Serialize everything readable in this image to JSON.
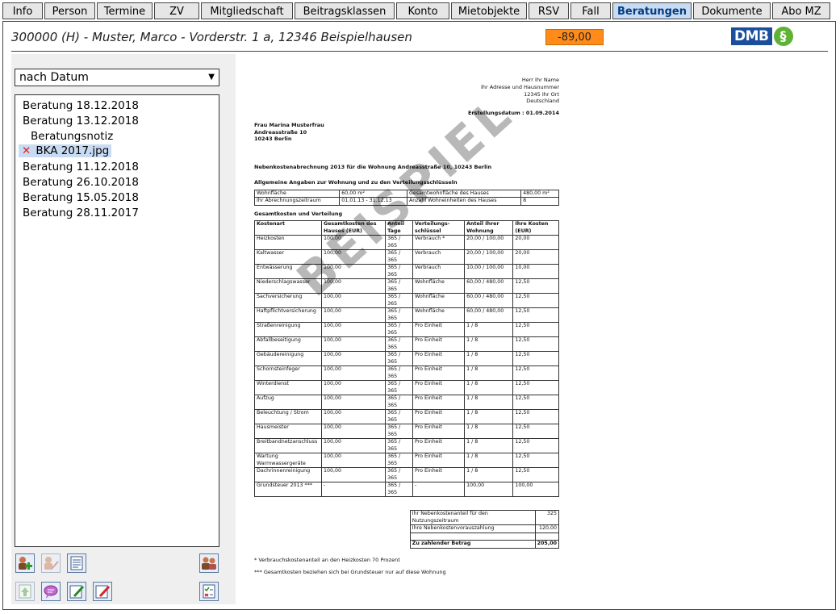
{
  "tabs": [
    {
      "label": "Info",
      "active": false
    },
    {
      "label": "Person",
      "active": false
    },
    {
      "label": "Termine",
      "active": false
    },
    {
      "label": "ZV",
      "active": false
    },
    {
      "label": "Mitgliedschaft",
      "active": false
    },
    {
      "label": "Beitragsklassen",
      "active": false
    },
    {
      "label": "Konto",
      "active": false
    },
    {
      "label": "Mietobjekte",
      "active": false
    },
    {
      "label": "RSV",
      "active": false
    },
    {
      "label": "Fall",
      "active": false
    },
    {
      "label": "Beratungen",
      "active": true
    },
    {
      "label": "Dokumente",
      "active": false
    },
    {
      "label": "Abo MZ",
      "active": false
    }
  ],
  "header": {
    "member_line": "300000 (H) - Muster, Marco - Vorderstr. 1 a, 12346 Beispielhausen",
    "balance": "-89,00",
    "logo_text": "DMB",
    "logo_symbol": "§"
  },
  "sort_select": {
    "value": "nach Datum"
  },
  "list": {
    "items": [
      {
        "label": "Beratung 18.12.2018",
        "kind": "item"
      },
      {
        "label": "Beratung 13.12.2018",
        "kind": "item"
      },
      {
        "label": "Beratungsnotiz",
        "kind": "sub"
      },
      {
        "label": "BKA 2017.jpg",
        "kind": "selected"
      },
      {
        "label": "Beratung 11.12.2018",
        "kind": "item"
      },
      {
        "label": "Beratung 26.10.2018",
        "kind": "item"
      },
      {
        "label": "Beratung 15.05.2018",
        "kind": "item"
      },
      {
        "label": "Beratung 28.11.2017",
        "kind": "item"
      }
    ]
  },
  "toolbar": {
    "icons": [
      "add-consultation-icon",
      "edit-person-icon",
      "document-list-icon",
      "persons-icon",
      "upload-icon",
      "note-icon",
      "edit-icon",
      "pin-icon",
      "checklist-icon"
    ]
  },
  "document": {
    "sender": [
      "Herr Ihr Name",
      "Ihr Adresse und Hausnummer",
      "12345 Ihr Ort",
      "Deutschland"
    ],
    "date_line": "Erstellungsdatum : 01.09.2014",
    "recipient": [
      "Frau Marina Musterfrau",
      "Andreasstraße 10",
      "10243 Berlin"
    ],
    "subject": "Nebenkostenabrechnung 2013 für die Wohnung Andreasstraße 10, 10243 Berlin",
    "general_heading": "Allgemeine Angaben zur Wohnung und zu den Verteilungsschlüsseln",
    "general_rows": [
      [
        "Wohnfläche",
        "60,00 m²",
        "Gesamtwohnfläche des Hauses",
        "480,00 m²"
      ],
      [
        "Ihr Abrechnungszeitraum",
        "01.01.13 - 31.12.13",
        "Anzahl Wohneinheiten des Hauses",
        "8"
      ]
    ],
    "costs_heading": "Gesamtkosten und Verteilung",
    "costs_header": [
      "Kostenart",
      "Gesamtkosten des Hauses (EUR)",
      "Anteil Tage",
      "Verteilungs-schlüssel",
      "Anteil Ihrer Wohnung",
      "Ihre Kosten (EUR)"
    ],
    "costs_rows": [
      [
        "Heizkosten",
        "100,00",
        "365 / 365",
        "Verbrauch *",
        "20,00 / 100,00",
        "20,00"
      ],
      [
        "Kaltwasser",
        "100,00",
        "365 / 365",
        "Verbrauch",
        "20,00 / 100,00",
        "20,00"
      ],
      [
        "Entwässerung",
        "100,00",
        "365 / 365",
        "Verbrauch",
        "10,00 / 100,00",
        "10,00"
      ],
      [
        "Niederschlagswasser",
        "100,00",
        "365 / 365",
        "Wohnfläche",
        "60,00 / 480,00",
        "12,50"
      ],
      [
        "Sachversicherung",
        "100,00",
        "365 / 365",
        "Wohnfläche",
        "60,00 / 480,00",
        "12,50"
      ],
      [
        "Haftpflichtversicherung",
        "100,00",
        "365 / 365",
        "Wohnfläche",
        "60,00 / 480,00",
        "12,50"
      ],
      [
        "Straßenreinigung",
        "100,00",
        "365 / 365",
        "Pro Einheit",
        "1 / 8",
        "12,50"
      ],
      [
        "Abfallbeseitigung",
        "100,00",
        "365 / 365",
        "Pro Einheit",
        "1 / 8",
        "12,50"
      ],
      [
        "Gebäudereinigung",
        "100,00",
        "365 / 365",
        "Pro Einheit",
        "1 / 8",
        "12,50"
      ],
      [
        "Schornsteinfeger",
        "100,00",
        "365 / 365",
        "Pro Einheit",
        "1 / 8",
        "12,50"
      ],
      [
        "Winterdienst",
        "100,00",
        "365 / 365",
        "Pro Einheit",
        "1 / 8",
        "12,50"
      ],
      [
        "Aufzug",
        "100,00",
        "365 / 365",
        "Pro Einheit",
        "1 / 8",
        "12,50"
      ],
      [
        "Beleuchtung / Strom",
        "100,00",
        "365 / 365",
        "Pro Einheit",
        "1 / 8",
        "12,50"
      ],
      [
        "Hausmeister",
        "100,00",
        "365 / 365",
        "Pro Einheit",
        "1 / 8",
        "12,50"
      ],
      [
        "Breitbandnetzanschluss",
        "100,00",
        "365 / 365",
        "Pro Einheit",
        "1 / 8",
        "12,50"
      ],
      [
        "Wartung Warmwassergeräte",
        "100,00",
        "365 / 365",
        "Pro Einheit",
        "1 / 8",
        "12,50"
      ],
      [
        "Dachrinnenreinigung",
        "100,00",
        "365 / 365",
        "Pro Einheit",
        "1 / 8",
        "12,50"
      ],
      [
        "Grundsteuer 2013 ***",
        "-",
        "365 / 365",
        "-",
        "100,00",
        "100,00"
      ]
    ],
    "summary_rows": [
      [
        "Ihr Nebenkostenanteil für den Nutzungszeitraum",
        "325"
      ],
      [
        "Ihre Nebenkostenvorauszahlung",
        "120,00"
      ],
      [
        "",
        ""
      ],
      [
        "Zu zahlender Betrag",
        "205,00"
      ]
    ],
    "footnotes": [
      "* Verbrauchskostenanteil an den Heizkosten 70 Prozent",
      "*** Gesamtkosten beziehen sich bei Grundsteuer nur auf diese Wohnung"
    ],
    "watermark": "BEISPIEL"
  }
}
